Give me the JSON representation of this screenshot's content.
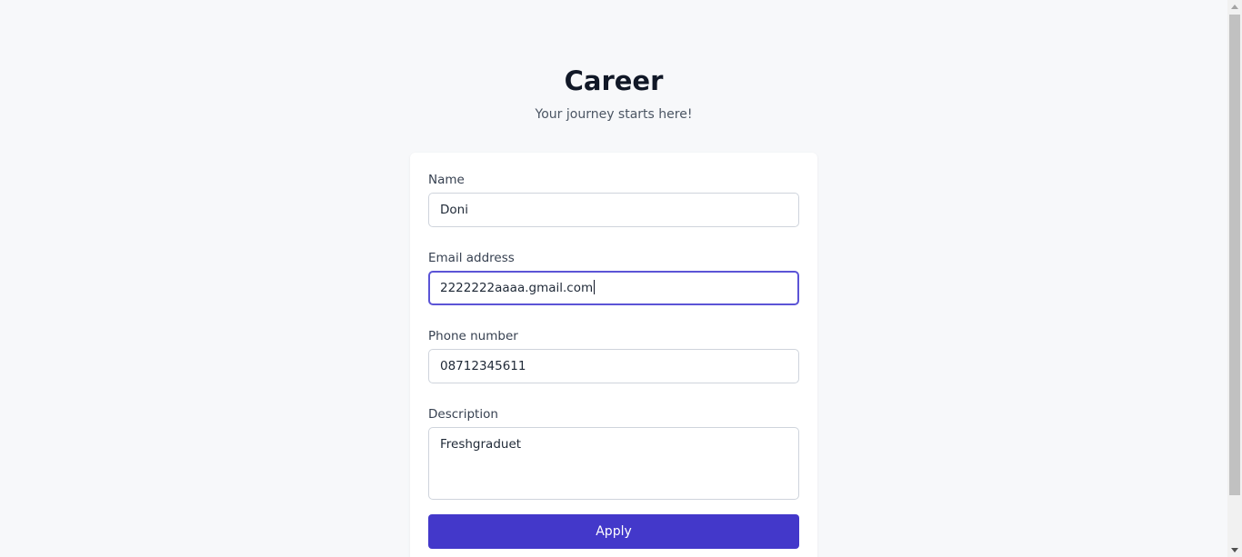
{
  "header": {
    "title": "Career",
    "subtitle": "Your journey starts here!"
  },
  "form": {
    "name": {
      "label": "Name",
      "value": "Doni"
    },
    "email": {
      "label": "Email address",
      "value": "2222222aaaa.gmail.com"
    },
    "phone": {
      "label": "Phone number",
      "value": "08712345611"
    },
    "description": {
      "label": "Description",
      "value": "Freshgraduet"
    },
    "apply_label": "Apply"
  },
  "colors": {
    "accent": "#4338ca",
    "focus_border": "#5b54d6",
    "background": "#f7f8fa"
  }
}
